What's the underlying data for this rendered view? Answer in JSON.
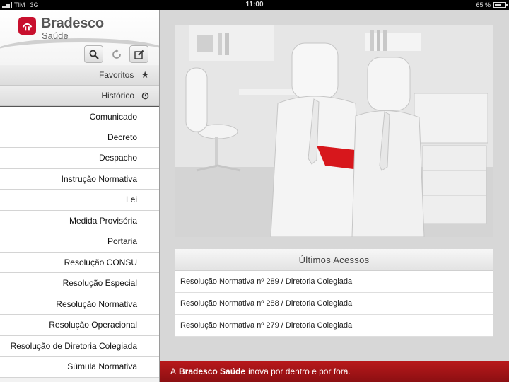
{
  "status_bar": {
    "carrier": "TIM",
    "network": "3G",
    "time": "11:00",
    "battery": "65 %",
    "battery_level": 0.65
  },
  "brand": {
    "name": "Bradesco",
    "sub": "Saúde",
    "accent_color": "#c8102e"
  },
  "toolbar": {
    "search_icon": "search-icon",
    "refresh_icon": "refresh-icon",
    "edit_icon": "edit-icon"
  },
  "sections": {
    "favorites_label": "Favoritos",
    "history_label": "Histórico"
  },
  "menu": [
    {
      "label": "Comunicado"
    },
    {
      "label": "Decreto"
    },
    {
      "label": "Despacho"
    },
    {
      "label": "Instrução Normativa"
    },
    {
      "label": "Lei"
    },
    {
      "label": "Medida Provisória"
    },
    {
      "label": "Portaria"
    },
    {
      "label": "Resolução CONSU"
    },
    {
      "label": "Resolução Especial"
    },
    {
      "label": "Resolução Normativa"
    },
    {
      "label": "Resolução Operacional"
    },
    {
      "label": "Resolução de Diretoria Colegiada"
    },
    {
      "label": "Súmula Normativa"
    }
  ],
  "recent": {
    "title": "Últimos Acessos",
    "items": [
      {
        "label": "Resolução Normativa nº 289 / Diretoria Colegiada"
      },
      {
        "label": "Resolução Normativa nº 288 / Diretoria Colegiada"
      },
      {
        "label": "Resolução Normativa nº 279 / Diretoria Colegiada"
      }
    ]
  },
  "footer": {
    "prefix": "A",
    "brand": "Bradesco Saúde",
    "suffix": "inova por dentro e por fora."
  }
}
